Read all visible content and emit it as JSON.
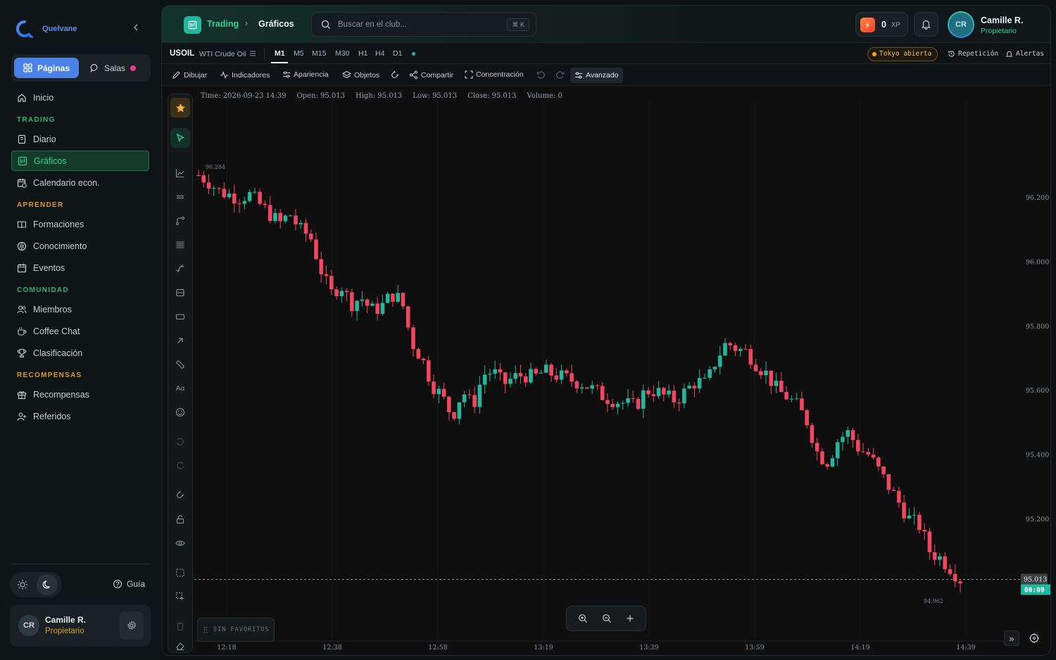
{
  "sidebar": {
    "brand": "Quelvane",
    "segment": {
      "pages_label": "Páginas",
      "rooms_label": "Salas"
    },
    "home_label": "Inicio",
    "sections": [
      {
        "title": "TRADING",
        "items": [
          {
            "label": "Diario"
          },
          {
            "label": "Gráficos",
            "active": true
          },
          {
            "label": "Calendario econ."
          }
        ]
      },
      {
        "title": "APRENDER",
        "items": [
          {
            "label": "Formaciones"
          },
          {
            "label": "Conocimiento"
          },
          {
            "label": "Eventos"
          }
        ]
      },
      {
        "title": "COMUNIDAD",
        "items": [
          {
            "label": "Miembros"
          },
          {
            "label": "Coffee Chat"
          },
          {
            "label": "Clasificación"
          }
        ]
      },
      {
        "title": "RECOMPENSAS",
        "items": [
          {
            "label": "Recompensas"
          },
          {
            "label": "Referidos"
          }
        ]
      }
    ],
    "guide_label": "Guía",
    "user": {
      "initials": "CR",
      "name": "Camille R.",
      "role": "Propietario"
    }
  },
  "topbar": {
    "crumb_section": "Trading",
    "crumb_page": "Gráficos",
    "search_placeholder": "Buscar en el club...",
    "search_shortcut": "⌘ K",
    "xp_value": "0",
    "xp_label": "XP",
    "user": {
      "initials": "CR",
      "name": "Camille R.",
      "role": "Propietario"
    }
  },
  "symbol_bar": {
    "symbol": "USOIL",
    "name": "WTI Crude Oil",
    "timeframes": [
      "M1",
      "M5",
      "M15",
      "M30",
      "H1",
      "H4",
      "D1"
    ],
    "active_timeframe": "M1",
    "session": "Tokyo abierta",
    "replay_label": "Repetición",
    "alerts_label": "Alertas"
  },
  "tools": {
    "draw": "Dibujar",
    "indicators": "Indicadores",
    "appearance": "Apariencia",
    "objects": "Objetos",
    "share": "Compartir",
    "focus": "Concentración",
    "advanced": "Avanzado"
  },
  "ohlc": {
    "time": "Time: 2026-09-23 14:39",
    "open": "Open: 95.013",
    "high": "High: 95.013",
    "low": "Low: 95.013",
    "close": "Close: 95.013",
    "volume": "Volume: 0"
  },
  "favorites_label": "SIN FAVORITOS",
  "colors": {
    "up": "#26b59a",
    "down": "#f0475f",
    "accent": "#34d399",
    "brand": "#4a82ea"
  },
  "chart_data": {
    "type": "candlestick",
    "symbol": "USOIL",
    "timeframe": "M1",
    "x_ticks": [
      "12:18",
      "12:38",
      "12:58",
      "13:19",
      "13:39",
      "13:59",
      "14:19",
      "14:39"
    ],
    "y_ticks": [
      "96.200",
      "96.000",
      "95.800",
      "95.600",
      "95.400",
      "95.200"
    ],
    "ylim": [
      95.005,
      96.32
    ],
    "last_price": "95.013",
    "countdown": "00:09",
    "high_label": "96.284",
    "low_label": "94.962",
    "close_path": [
      96.27,
      96.25,
      96.22,
      96.21,
      96.2,
      96.21,
      96.18,
      96.15,
      96.12,
      96.15,
      96.1,
      96.08,
      95.98,
      95.9,
      95.93,
      95.87,
      95.89,
      95.85,
      95.86,
      95.9,
      95.88,
      95.75,
      95.7,
      95.62,
      95.58,
      95.52,
      95.6,
      95.55,
      95.65,
      95.66,
      95.62,
      95.64,
      95.65,
      95.64,
      95.66,
      95.65,
      95.64,
      95.63,
      95.62,
      95.6,
      95.58,
      95.57,
      95.56,
      95.55,
      95.6,
      95.6,
      95.58,
      95.57,
      95.6,
      95.63,
      95.62,
      95.7,
      95.75,
      95.73,
      95.72,
      95.68,
      95.65,
      95.6,
      95.58,
      95.55,
      95.5,
      95.4,
      95.38,
      95.45,
      95.47,
      95.42,
      95.4,
      95.35,
      95.3,
      95.25,
      95.2,
      95.18,
      95.1,
      95.08,
      95.05,
      95.013
    ]
  }
}
